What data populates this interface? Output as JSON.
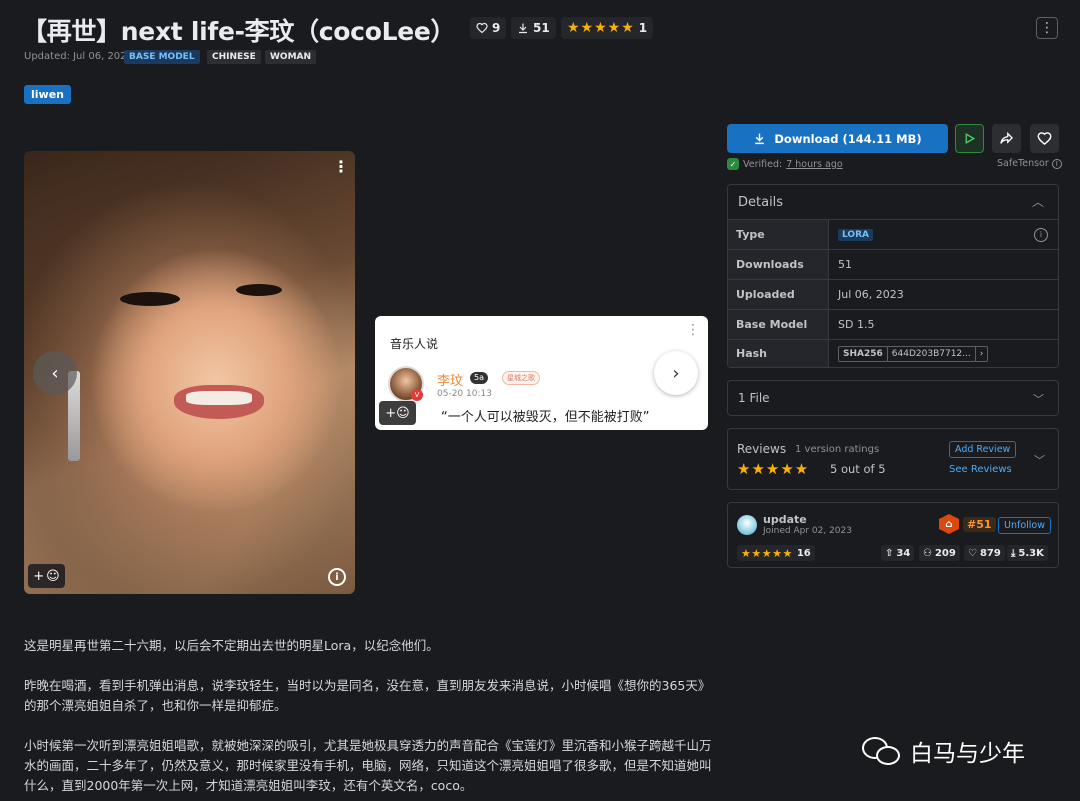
{
  "header": {
    "title": "【再世】next life-李玟（cocoLee）",
    "likes": "9",
    "downloads": "51",
    "rating_count": "1",
    "updated": "Updated: Jul 06, 2023",
    "badges": [
      "BASE MODEL",
      "CHINESE",
      "WOMAN"
    ],
    "tag": "liwen"
  },
  "gallery": {
    "card_title": "音乐人说",
    "card_name": "李玟",
    "card_level": "5a",
    "card_medal": "星城之歌",
    "card_time": "05-20 10:13",
    "card_quote": "“一个人可以被毁灭，但不能被打败”"
  },
  "description": [
    "这是明星再世第二十六期，以后会不定期出去世的明星Lora，以纪念他们。",
    "昨晚在喝酒，看到手机弹出消息，说李玟轻生，当时以为是同名，没在意，直到朋友发来消息说，小时候唱《想你的365天》的那个漂亮姐姐自杀了，也和你一样是抑郁症。",
    "小时候第一次听到漂亮姐姐唱歌，就被她深深的吸引，尤其是她极具穿透力的声音配合《宝莲灯》里沉香和小猴子跨越千山万水的画面，二十多年了，仍然及意义，那时候家里没有手机，电脑，网络，只知道这个漂亮姐姐唱了很多歌，但是不知道她叫什么，直到2000年第一次上网，才知道漂亮姐姐叫李玟，还有个英文名，coco。"
  ],
  "download": {
    "label": "Download (144.11 MB)",
    "verified": "Verified:",
    "verified_time": "7 hours ago",
    "safetensor": "SafeTensor"
  },
  "details": {
    "title": "Details",
    "rows": [
      {
        "key": "Type",
        "value": "LORA"
      },
      {
        "key": "Downloads",
        "value": "51"
      },
      {
        "key": "Uploaded",
        "value": "Jul 06, 2023"
      },
      {
        "key": "Base Model",
        "value": "SD 1.5"
      },
      {
        "key": "Hash",
        "value": "644D203B7712..."
      }
    ],
    "hash_algo": "SHA256"
  },
  "files": {
    "label": "1 File"
  },
  "reviews": {
    "title": "Reviews",
    "subtitle": "1 version ratings",
    "score": "5 out of 5",
    "add": "Add Review",
    "see": "See Reviews",
    "rating": 5
  },
  "creator": {
    "name": "update",
    "joined": "Joined Apr 02, 2023",
    "rank": "#51",
    "unfollow": "Unfollow",
    "rating_count": "16",
    "uploads": "34",
    "followers": "209",
    "likes": "879",
    "downloads": "5.3K"
  },
  "watermark": "白马与少年",
  "colors": {
    "accent": "#1971c2",
    "star": "#fab005",
    "background": "#1a1b1e"
  }
}
